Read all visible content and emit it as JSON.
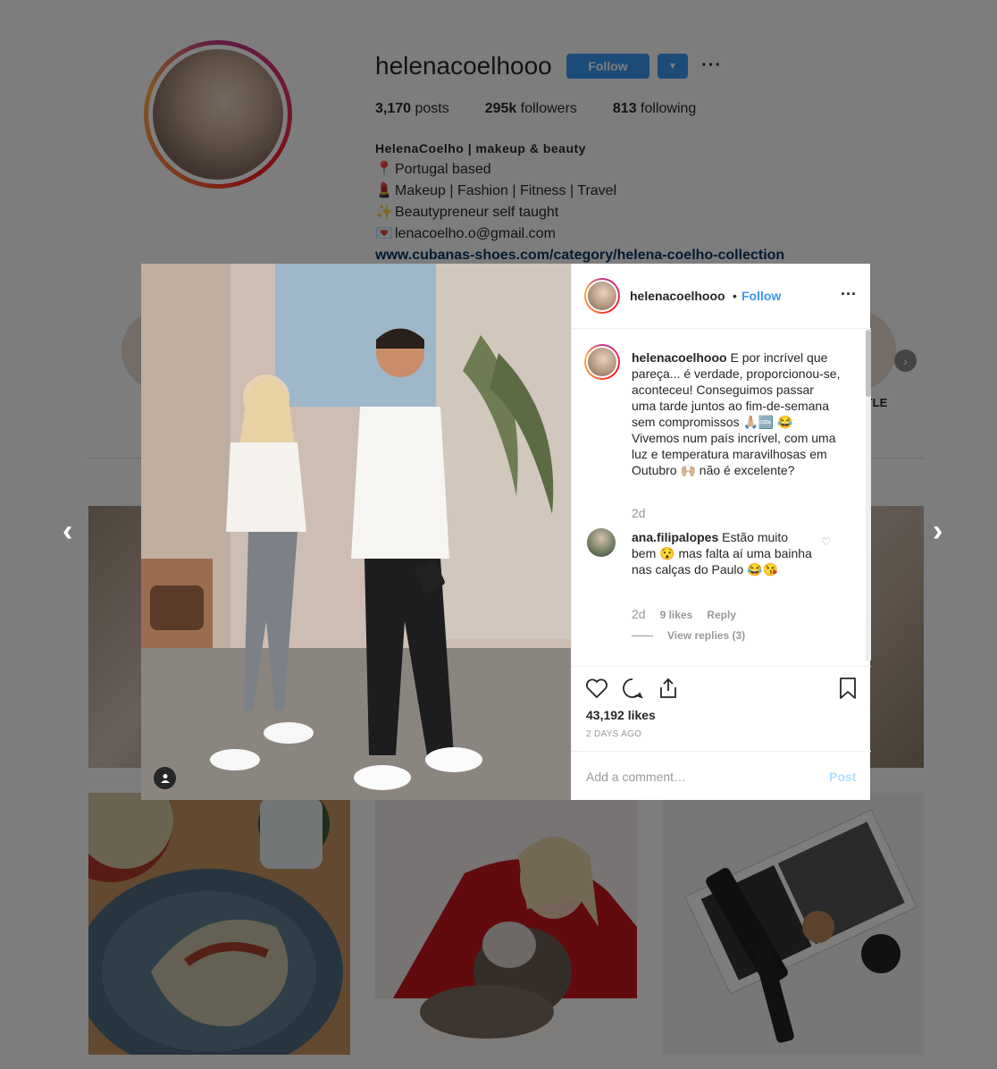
{
  "profile": {
    "username": "helenacoelhooo",
    "follow_label": "Follow",
    "options_label": "···",
    "stats": {
      "posts_count": "3,170",
      "posts_label": " posts",
      "followers_count": "295k",
      "followers_label": " followers",
      "following_count": "813",
      "following_label": " following"
    },
    "bio": {
      "name": "HelenaCoelho | makeup & beauty",
      "line1_icon": "📍",
      "line1": "Portugal based",
      "line2_icon": "💄",
      "line2": "Makeup | Fashion | Fitness | Travel",
      "line3_icon": "✨",
      "line3": "Beautypreneur self taught",
      "line4_icon": "💌",
      "line4": "lenacoelho.o@gmail.com",
      "link": "www.cubanas-shoes.com/category/helena-coelho-collection"
    },
    "highlight_partial_label": "YLE"
  },
  "modal": {
    "header": {
      "username": "helenacoelhooo",
      "dot": "•",
      "follow_label": "Follow",
      "more": "···"
    },
    "caption": {
      "username": "helenacoelhooo",
      "text": " E por incrível que pareça... é verdade, proporcionou-se, aconteceu! Conseguimos passar uma tarde juntos ao fim-de-semana sem compromissos 🙏🏼🆒 😂 Vivemos num país incrível, com uma luz e temperatura maravilhosas em Outubro 🙌🏼 não é excelente?",
      "time": "2d"
    },
    "comment": {
      "username": "ana.filipalopes",
      "text": " Estão muito bem 😯 mas falta aí uma bainha nas calças do Paulo 😂😘",
      "time": "2d",
      "likes": "9 likes",
      "reply": "Reply",
      "view_replies": "View replies (3)"
    },
    "likes": "43,192 likes",
    "posted_ago": "2 DAYS AGO",
    "add_comment_placeholder": "Add a comment…",
    "post_label": "Post"
  },
  "icons": {
    "heart": "heart-icon",
    "comment": "comment-icon",
    "share": "share-icon",
    "bookmark": "bookmark-icon",
    "nav_prev": "chevron-left-icon",
    "nav_next": "chevron-right-icon"
  },
  "colors": {
    "accent": "#3897f0",
    "post_disabled": "#b2dffc",
    "overlay": "rgba(0,0,0,0.5)"
  }
}
